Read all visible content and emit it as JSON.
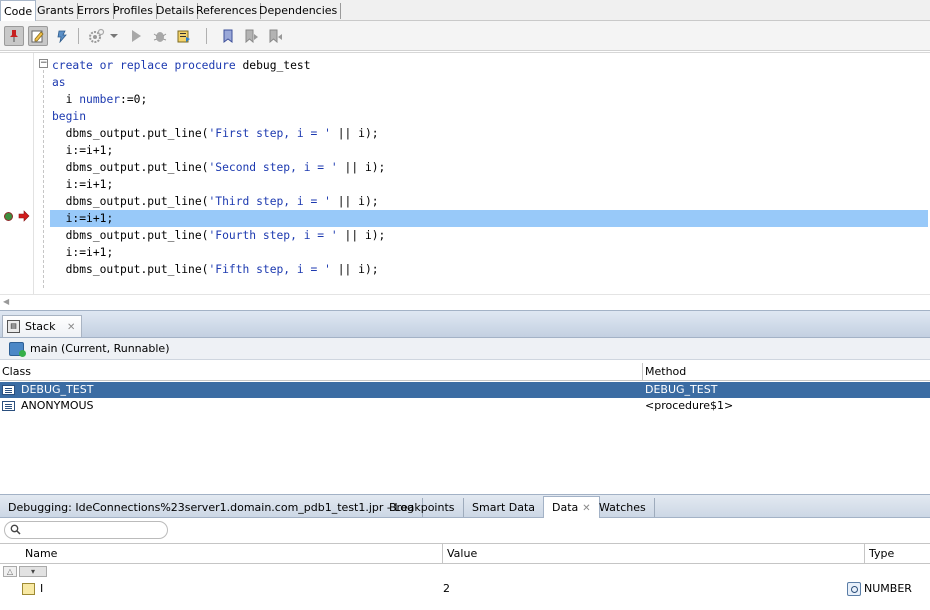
{
  "editor_tabs": [
    {
      "label": "Code",
      "active": true
    },
    {
      "label": "Grants"
    },
    {
      "label": "Errors"
    },
    {
      "label": "Profiles"
    },
    {
      "label": "Details"
    },
    {
      "label": "References"
    },
    {
      "label": "Dependencies"
    }
  ],
  "toolbar": {
    "icons": [
      "pin-icon",
      "edit-icon",
      "compile-debug-icon",
      "settings-gear-icon",
      "dropdown-icon",
      "run-icon",
      "debug-bug-icon",
      "compile-icon",
      "bookmark-icon",
      "bookmark-next-icon",
      "bookmark-prev-icon"
    ]
  },
  "code": {
    "lines": [
      "create or replace procedure debug_test",
      "as",
      "  i number:=0;",
      "begin",
      "  dbms_output.put_line('First step, i = ' || i);",
      "  i:=i+1;",
      "  dbms_output.put_line('Second step, i = ' || i);",
      "  i:=i+1;",
      "  dbms_output.put_line('Third step, i = ' || i);",
      "  i:=i+1;",
      "  dbms_output.put_line('Fourth step, i = ' || i);",
      "  i:=i+1;",
      "  dbms_output.put_line('Fifth step, i = ' || i);"
    ],
    "current_line_index": 9
  },
  "stack_panel": {
    "tab_label": "Stack",
    "thread_label": "main (Current, Runnable)",
    "columns": {
      "class": "Class",
      "method": "Method"
    },
    "rows": [
      {
        "class": "DEBUG_TEST",
        "method": "DEBUG_TEST",
        "selected": true
      },
      {
        "class": "ANONYMOUS",
        "method": "<procedure$1>"
      }
    ]
  },
  "bottom_tabs": [
    {
      "label": "Debugging: IdeConnections%23server1.domain.com_pdb1_test1.jpr - Log"
    },
    {
      "label": "Breakpoints"
    },
    {
      "label": "Smart Data"
    },
    {
      "label": "Data",
      "active": true
    },
    {
      "label": "Watches"
    }
  ],
  "data_panel": {
    "search_placeholder": "",
    "columns": {
      "name": "Name",
      "value": "Value",
      "type": "Type"
    },
    "rows": [
      {
        "name": "I",
        "value": "2",
        "type": "NUMBER"
      }
    ]
  },
  "colors": {
    "current_line": "#98c9f9",
    "selected_row": "#3b6ca3",
    "keyword": "#1d3ab0"
  }
}
